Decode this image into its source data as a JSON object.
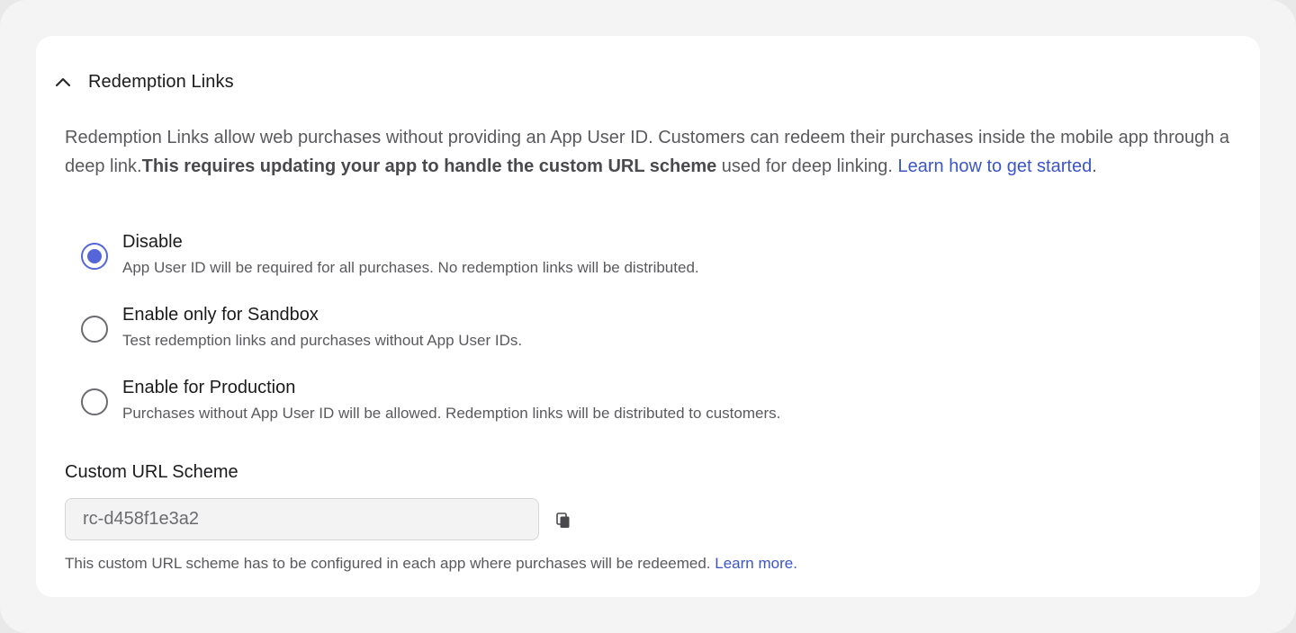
{
  "section": {
    "title": "Redemption Links",
    "expanded": true,
    "description": {
      "text_before": "Redemption Links allow web purchases without providing an App User ID. Customers can redeem their purchases inside the mobile app through a deep link.",
      "bold_text": "This requires updating your app to handle the custom URL scheme",
      "text_after": " used for deep linking. ",
      "link_text": "Learn how to get started",
      "trailing": "."
    }
  },
  "options": [
    {
      "label": "Disable",
      "sublabel": "App User ID will be required for all purchases. No redemption links will be distributed.",
      "selected": true
    },
    {
      "label": "Enable only for Sandbox",
      "sublabel": "Test redemption links and purchases without App User IDs.",
      "selected": false
    },
    {
      "label": "Enable for Production",
      "sublabel": "Purchases without App User ID will be allowed. Redemption links will be distributed to customers.",
      "selected": false
    }
  ],
  "url_scheme": {
    "label": "Custom URL Scheme",
    "value": "rc-d458f1e3a2",
    "help_text": "This custom URL scheme has to be configured in each app where purchases will be redeemed. ",
    "help_link": "Learn more."
  },
  "colors": {
    "accent": "#5567d8",
    "link": "#3b55c9"
  },
  "icons": {
    "collapse": "chevron-up-icon",
    "copy": "copy-icon"
  }
}
